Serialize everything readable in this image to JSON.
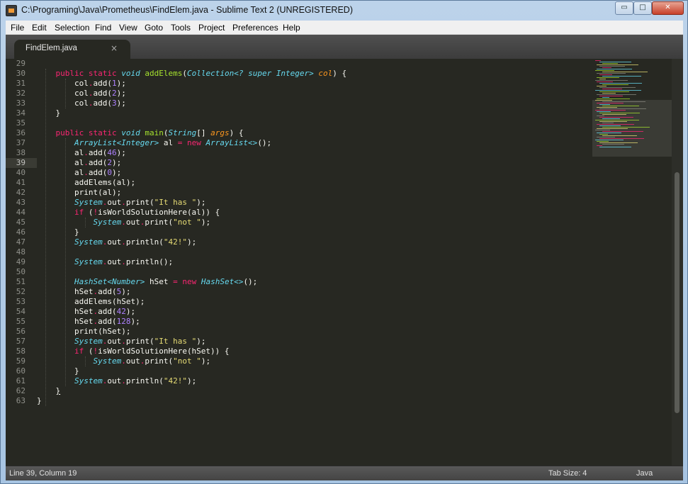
{
  "window": {
    "title": "C:\\Programing\\Java\\Prometheus\\FindElem.java - Sublime Text 2 (UNREGISTERED)",
    "minimize": "▭",
    "maximize": "□",
    "close": "✕"
  },
  "menu": [
    "File",
    "Edit",
    "Selection",
    "Find",
    "View",
    "Goto",
    "Tools",
    "Project",
    "Preferences",
    "Help"
  ],
  "tab": {
    "label": "FindElem.java",
    "close": "×"
  },
  "line_numbers": [
    "29",
    "30",
    "31",
    "32",
    "33",
    "34",
    "35",
    "36",
    "37",
    "38",
    "39",
    "40",
    "41",
    "42",
    "43",
    "44",
    "45",
    "46",
    "47",
    "48",
    "49",
    "50",
    "51",
    "52",
    "53",
    "54",
    "55",
    "56",
    "57",
    "58",
    "59",
    "60",
    "61",
    "62",
    "63"
  ],
  "active_line": "39",
  "status": {
    "position": "Line 39, Column 19",
    "tab_size": "Tab Size: 4",
    "syntax": "Java"
  },
  "colors": {
    "background": "#272822",
    "keyword": "#f92672",
    "type": "#66d9ef",
    "function": "#a6e22e",
    "string": "#e6db74",
    "number": "#ae81ff",
    "parameter": "#fd971f"
  }
}
